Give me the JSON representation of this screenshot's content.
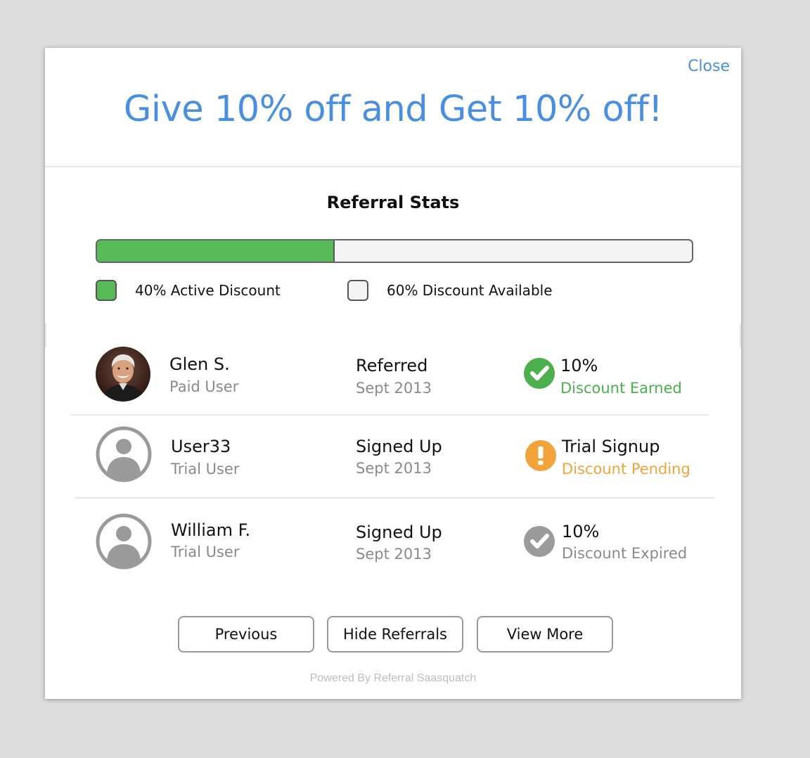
{
  "modal": {
    "close_label": "Close",
    "headline": "Give 10% off and Get 10% off!"
  },
  "stats": {
    "title": "Referral Stats",
    "progress_fraction": 0.4,
    "active_label": "40% Active Discount",
    "available_label": "60% Discount Available",
    "active_color": "#57b957",
    "available_color": "#f3f3f3"
  },
  "referrals": [
    {
      "name": "Glen S.",
      "user_type": "Paid User",
      "action": "Referred",
      "date": "Sept 2013",
      "status_title": "10%",
      "status_sub": "Discount Earned",
      "status_icon": "checkmark-icon",
      "status_color": "#4cb04c",
      "avatar": "photo"
    },
    {
      "name": "User33",
      "user_type": "Trial User",
      "action": "Signed Up",
      "date": "Sept 2013",
      "status_title": "Trial Signup",
      "status_sub": "Discount Pending",
      "status_icon": "exclamation-icon",
      "status_color": "#f2a43b",
      "avatar": "placeholder"
    },
    {
      "name": "William F.",
      "user_type": "Trial User",
      "action": "Signed Up",
      "date": "Sept 2013",
      "status_title": "10%",
      "status_sub": "Discount Expired",
      "status_icon": "checkmark-icon",
      "status_color": "#9b9b9b",
      "avatar": "placeholder"
    }
  ],
  "buttons": {
    "previous": "Previous",
    "hide": "Hide Referrals",
    "view_more": "View More"
  },
  "footer": {
    "powered_by": "Powered By Referral Saasquatch"
  }
}
